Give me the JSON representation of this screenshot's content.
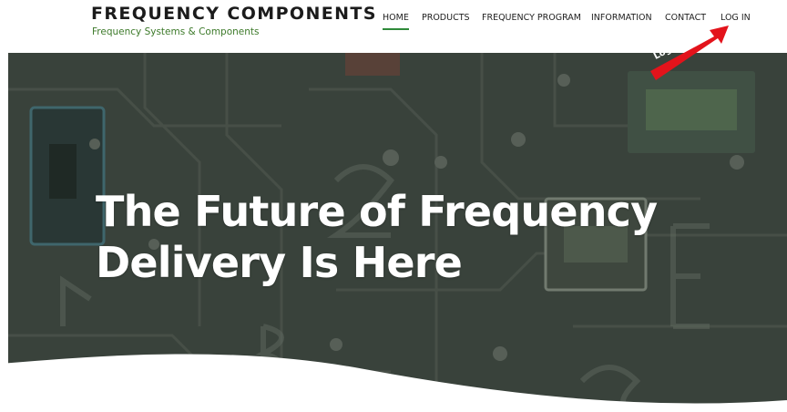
{
  "brand": {
    "title": "FREQUENCY COMPONENTS",
    "tagline": "Frequency Systems & Components"
  },
  "nav": {
    "items": [
      {
        "label": "HOME",
        "active": true
      },
      {
        "label": "PRODUCTS",
        "active": false
      },
      {
        "label": "FREQUENCY PROGRAM",
        "active": false
      },
      {
        "label": "INFORMATION",
        "active": false
      },
      {
        "label": "CONTACT",
        "active": false
      },
      {
        "label": "LOG IN",
        "active": false
      }
    ]
  },
  "hero": {
    "heading_line1": "The Future of Frequency",
    "heading_line2": "Delivery Is Here"
  },
  "annotation": {
    "label": "Log In",
    "color": "#e3131b"
  },
  "colors": {
    "brand_green": "#3d7a2a",
    "nav_active_underline": "#2f8a3a",
    "hero_overlay": "#3d4640"
  }
}
